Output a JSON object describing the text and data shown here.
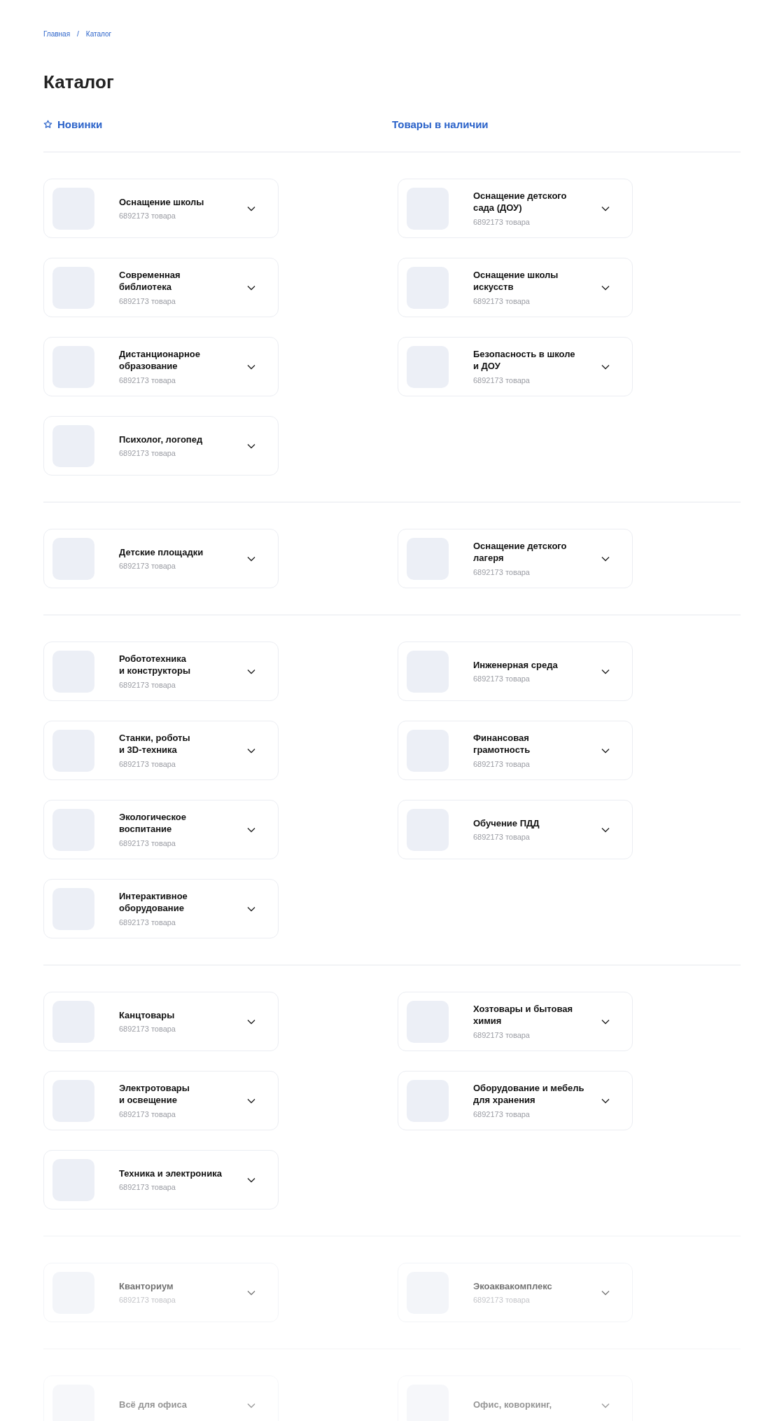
{
  "breadcrumbs": [
    {
      "label": "Главная"
    },
    {
      "label": "Каталог"
    }
  ],
  "breadcrumb_separator": "/",
  "title": "Каталог",
  "quick_links": [
    {
      "label": "Новинки",
      "kind": "star"
    },
    {
      "label": "Товары в наличии",
      "kind": "plain"
    }
  ],
  "sections": [
    {
      "faded": false,
      "columns": [
        [
          {
            "title": "Оснащение школы",
            "count": "6892173 товара"
          },
          {
            "title": "Современная\nбиблиотека",
            "count": "6892173 товара"
          },
          {
            "title": "Дистанционарное\nобразование",
            "count": "6892173 товара"
          },
          {
            "title": "Психолог, логопед",
            "count": "6892173 товара"
          }
        ],
        [
          {
            "title": "Оснащение детского\nсада (ДОУ)",
            "count": "6892173 товара"
          },
          {
            "title": "Оснащение школы\nискусств",
            "count": "6892173 товара"
          },
          {
            "title": "Безопасность в школе\nи ДОУ",
            "count": "6892173 товара"
          }
        ]
      ]
    },
    {
      "faded": false,
      "columns": [
        [
          {
            "title": "Детские площадки",
            "count": "6892173 товара"
          }
        ],
        [
          {
            "title": "Оснащение детского\nлагеря",
            "count": "6892173 товара"
          }
        ]
      ]
    },
    {
      "faded": false,
      "columns": [
        [
          {
            "title": "Робототехника\nи конструкторы",
            "count": "6892173 товара"
          },
          {
            "title": "Станки, роботы\nи 3D-техника",
            "count": "6892173 товара"
          },
          {
            "title": "Экологическое\nвоспитание",
            "count": "6892173 товара"
          },
          {
            "title": "Интерактивное\nоборудование",
            "count": "6892173 товара"
          }
        ],
        [
          {
            "title": "Инженерная среда",
            "count": "6892173 товара"
          },
          {
            "title": "Финансовая\nграмотность",
            "count": "6892173 товара"
          },
          {
            "title": "Обучение ПДД",
            "count": "6892173 товара"
          }
        ]
      ]
    },
    {
      "faded": false,
      "columns": [
        [
          {
            "title": "Канцтовары",
            "count": "6892173 товара"
          },
          {
            "title": "Электротовары\nи освещение",
            "count": "6892173 товара"
          },
          {
            "title": "Техника и электроника",
            "count": "6892173 товара"
          }
        ],
        [
          {
            "title": "Хозтовары и бытовая\nхимия",
            "count": "6892173 товара"
          },
          {
            "title": "Оборудование и мебель\nдля хранения",
            "count": "6892173 товара"
          }
        ]
      ]
    },
    {
      "faded": true,
      "columns": [
        [
          {
            "title": "Кванториум",
            "count": "6892173 товара"
          }
        ],
        [
          {
            "title": "Экоаквакомплекс",
            "count": "6892173 товара"
          }
        ]
      ]
    },
    {
      "faded": true,
      "columns": [
        [
          {
            "title": "Всё для офиса"
          }
        ],
        [
          {
            "title": "Офис, коворкинг,"
          }
        ]
      ]
    }
  ]
}
